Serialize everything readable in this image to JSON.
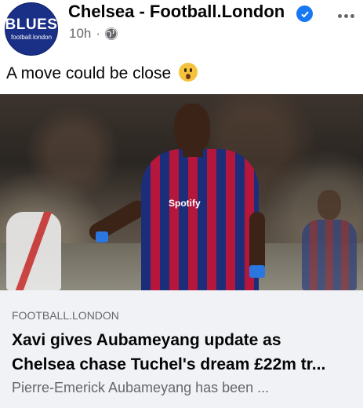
{
  "post": {
    "page_name": "Chelsea - Football.London",
    "avatar_main": "BLUES",
    "avatar_sub": "football.london",
    "timestamp": "10h",
    "separator": "·",
    "caption": "A move could be close"
  },
  "link_preview": {
    "domain": "FOOTBALL.LONDON",
    "headline_line1": "Xavi gives Aubameyang update as",
    "headline_line2": "Chelsea chase Tuchel's dream £22m tr...",
    "description": "Pierre-Emerick Aubameyang has been ...",
    "shirt_sponsor": "Spotify"
  },
  "icons": {
    "verified": "verified-badge-icon",
    "audience": "globe-icon",
    "more": "more-options-icon",
    "emoji": "astonished-face-emoji"
  },
  "colors": {
    "verified_blue": "#1877f2",
    "muted_text": "#65676b",
    "card_bg": "#f0f2f5",
    "avatar_bg": "#1a2f86"
  }
}
